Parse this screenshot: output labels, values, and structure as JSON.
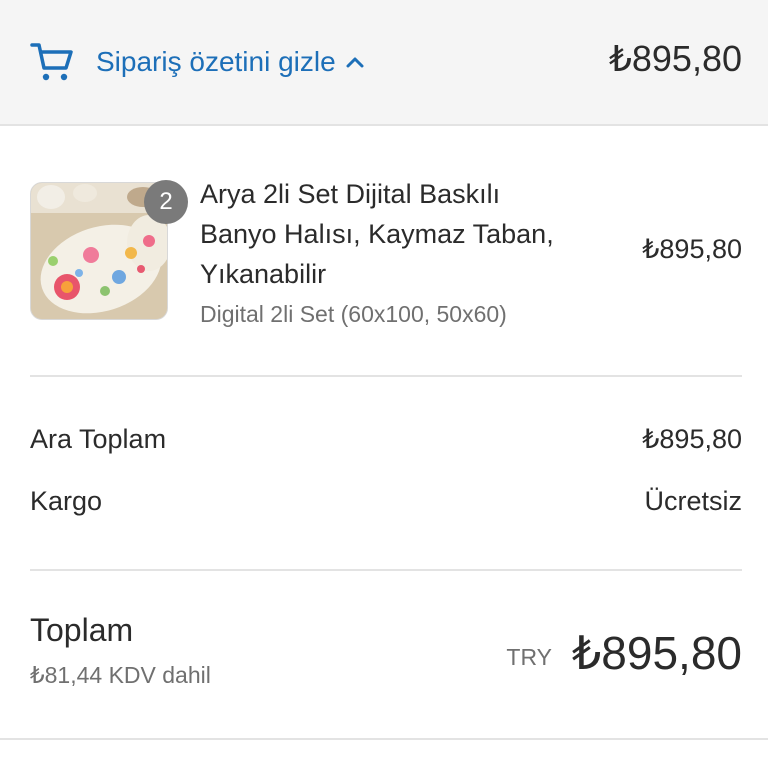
{
  "header": {
    "toggle_label": "Sipariş özetini gizle",
    "total": "₺895,80"
  },
  "product": {
    "quantity": "2",
    "title": "Arya 2li Set Dijital Baskılı Banyo Halısı, Kaymaz Taban, Yıkanabilir",
    "variant": "Digital 2li Set (60x100, 50x60)",
    "price": "₺895,80",
    "image": "bath-rug-set-image"
  },
  "summary": {
    "subtotal_label": "Ara Toplam",
    "subtotal_value": "₺895,80",
    "shipping_label": "Kargo",
    "shipping_value": "Ücretsiz"
  },
  "total": {
    "label": "Toplam",
    "tax_note": "₺81,44 KDV dahil",
    "currency": "TRY",
    "amount": "₺895,80"
  },
  "colors": {
    "accent": "#1d6fb8",
    "header_bg": "#f5f5f5",
    "badge": "#7a7a7a"
  }
}
